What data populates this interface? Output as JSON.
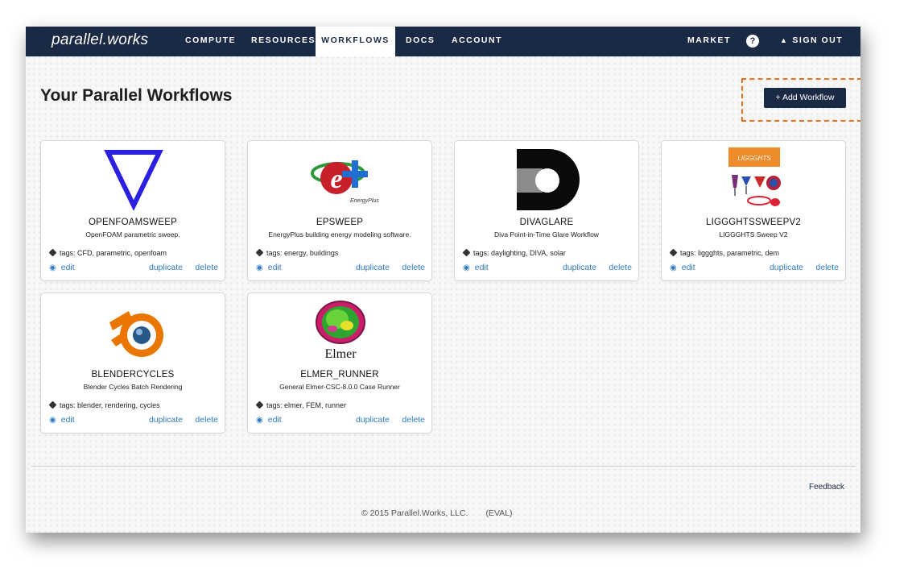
{
  "nav": {
    "brand": "parallel.works",
    "items": [
      "COMPUTE",
      "RESOURCES",
      "WORKFLOWS",
      "DOCS",
      "ACCOUNT"
    ],
    "active": "WORKFLOWS",
    "market": "MARKET",
    "help": "?",
    "sign_out": "SIGN OUT"
  },
  "header": {
    "title": "Your Parallel Workflows",
    "add_button": "+ Add Workflow"
  },
  "cards": [
    {
      "name": "OPENFOAMSWEEP",
      "desc": "OpenFOAM parametric sweep.",
      "tags": "tags: CFD, parametric, openfoam",
      "edit": "edit",
      "duplicate": "duplicate",
      "delete": "delete",
      "logo": "openfoam-logo"
    },
    {
      "name": "EPSWEEP",
      "desc": "EnergyPlus building energy modeling software.",
      "tags": "tags: energy, buildings",
      "edit": "edit",
      "duplicate": "duplicate",
      "delete": "delete",
      "logo": "energyplus-logo",
      "logo_text": "EnergyPlus"
    },
    {
      "name": "DIVAGLARE",
      "desc": "Diva Point-in-Time Glare Workflow",
      "tags": "tags: daylighting, DIVA, solar",
      "edit": "edit",
      "duplicate": "duplicate",
      "delete": "delete",
      "logo": "diva-logo"
    },
    {
      "name": "LIGGGHTSSWEEPV2",
      "desc": "LIGGGHTS Sweep V2",
      "tags": "tags: liggghts, parametric, dem",
      "edit": "edit",
      "duplicate": "duplicate",
      "delete": "delete",
      "logo": "liggghts-logo",
      "logo_text": "LIGGGHTS"
    },
    {
      "name": "BLENDERCYCLES",
      "desc": "Blender Cycles Batch Rendering",
      "tags": "tags: blender, rendering, cycles",
      "edit": "edit",
      "duplicate": "duplicate",
      "delete": "delete",
      "logo": "blender-logo"
    },
    {
      "name": "ELMER_RUNNER",
      "desc": "General Elmer-CSC-8.0.0 Case Runner",
      "tags": "tags: elmer, FEM, runner",
      "edit": "edit",
      "duplicate": "duplicate",
      "delete": "delete",
      "logo": "elmer-logo",
      "logo_text": "Elmer"
    }
  ],
  "footer": {
    "feedback": "Feedback",
    "copyright": "© 2015 Parallel.Works, LLC.",
    "eval": "(EVAL)"
  },
  "colors": {
    "navbar": "#1b2a44",
    "link": "#2f7bbf",
    "highlight": "#e8721f"
  }
}
